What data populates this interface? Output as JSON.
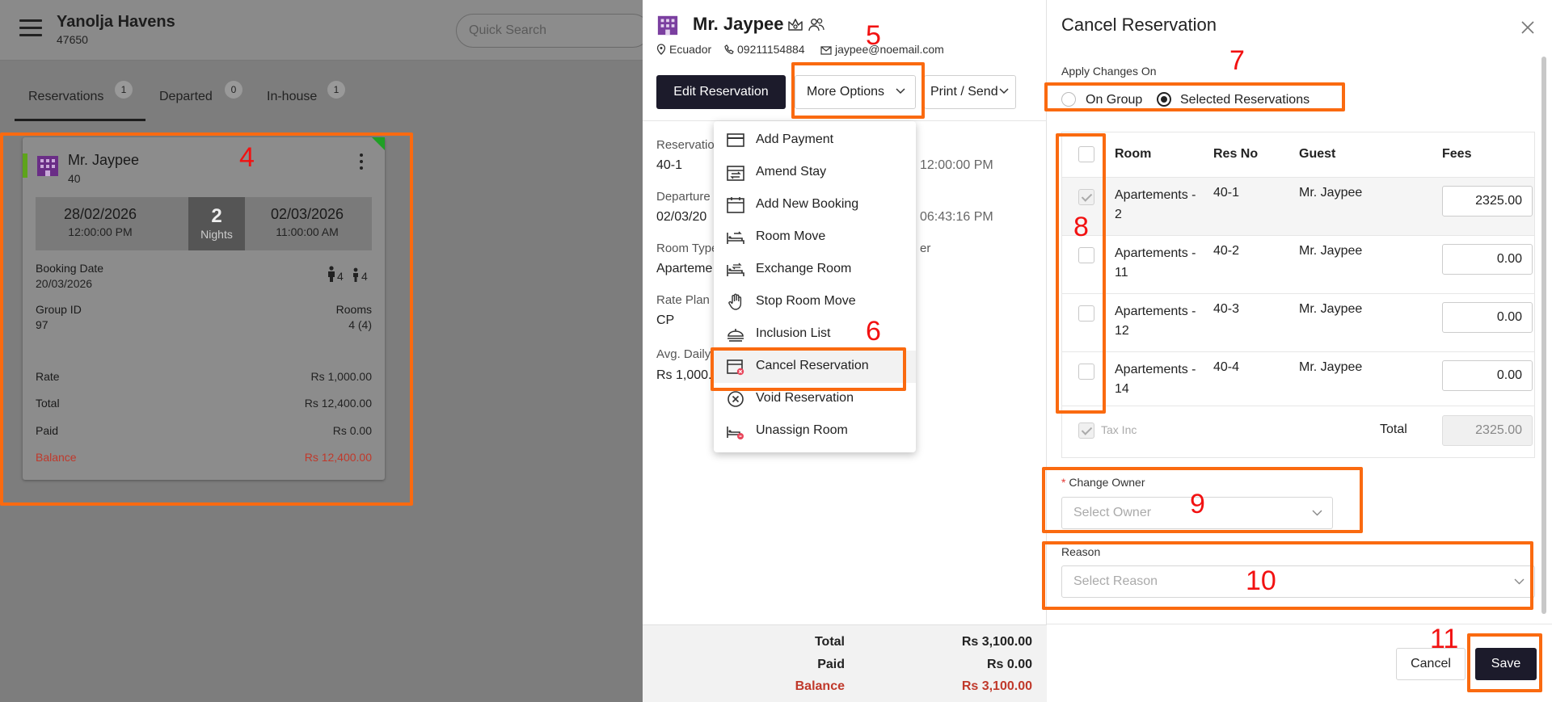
{
  "app": {
    "hotel_name": "Yanolja Havens",
    "hotel_code": "47650",
    "search_placeholder": "Quick Search",
    "tabs": [
      {
        "label": "Reservations",
        "count": "1"
      },
      {
        "label": "Departed",
        "count": "0"
      },
      {
        "label": "In-house",
        "count": "1"
      }
    ]
  },
  "card": {
    "name": "Mr. Jaypee",
    "id": "40",
    "arrival_date": "28/02/2026",
    "arrival_time": "12:00:00 PM",
    "nights": "2",
    "nights_label": "Nights",
    "departure_date": "02/03/2026",
    "departure_time": "11:00:00 AM",
    "booking_date_label": "Booking Date",
    "booking_date": "20/03/2026",
    "adults": "4",
    "children": "4",
    "group_id_label": "Group ID",
    "group_id": "97",
    "rooms_label": "Rooms",
    "rooms": "4 (4)",
    "rate_label": "Rate",
    "rate": "Rs 1,000.00",
    "total_label": "Total",
    "total": "Rs 12,400.00",
    "paid_label": "Paid",
    "paid": "Rs 0.00",
    "balance_label": "Balance",
    "balance": "Rs 12,400.00"
  },
  "detail": {
    "guest_name": "Mr. Jaypee",
    "country": "Ecuador",
    "phone": "09211154884",
    "email": "jaypee@noemail.com",
    "edit_button": "Edit Reservation",
    "more_button": "More Options",
    "print_button": "Print / Send",
    "fields": {
      "reservation_label": "Reservatio",
      "reservation_value": "40-1",
      "arrival_time_tail": "12:00:00 PM",
      "departure_label": "Departure",
      "departure_value": "02/03/20",
      "departure_time_tail": "06:43:16 PM",
      "room_type_label": "Room Type",
      "room_type_value": "Aparteme",
      "owner_tail": "er",
      "rate_plan_label": "Rate Plan",
      "rate_plan_value": "CP",
      "avg_label": "Avg. Daily",
      "avg_value": "Rs 1,000."
    },
    "footer": {
      "total_label": "Total",
      "total": "Rs 3,100.00",
      "paid_label": "Paid",
      "paid": "Rs 0.00",
      "balance_label": "Balance",
      "balance": "Rs 3,100.00"
    }
  },
  "more_options_menu": [
    {
      "label": "Add Payment",
      "icon": "card-icon"
    },
    {
      "label": "Amend Stay",
      "icon": "calendar-swap-icon"
    },
    {
      "label": "Add New Booking",
      "icon": "calendar-icon"
    },
    {
      "label": "Room Move",
      "icon": "bed-move-icon"
    },
    {
      "label": "Exchange Room",
      "icon": "bed-exchange-icon"
    },
    {
      "label": "Stop Room Move",
      "icon": "hand-stop-icon"
    },
    {
      "label": "Inclusion List",
      "icon": "cutlery-icon"
    },
    {
      "label": "Cancel Reservation",
      "icon": "calendar-cancel-icon"
    },
    {
      "label": "Void Reservation",
      "icon": "circle-x-icon"
    },
    {
      "label": "Unassign Room",
      "icon": "bed-unassign-icon"
    }
  ],
  "cancel_panel": {
    "title": "Cancel Reservation",
    "apply_label": "Apply Changes On",
    "option_group": "On Group",
    "option_selected": "Selected Reservations",
    "selected_option": "Selected Reservations",
    "columns": [
      "Room",
      "Res No",
      "Guest",
      "Fees"
    ],
    "rows": [
      {
        "room": "Apartements - 2",
        "res_no": "40-1",
        "guest": "Mr. Jaypee",
        "fee": "2325.00",
        "checked": true
      },
      {
        "room": "Apartements - 11",
        "res_no": "40-2",
        "guest": "Mr. Jaypee",
        "fee": "0.00",
        "checked": false
      },
      {
        "room": "Apartements - 12",
        "res_no": "40-3",
        "guest": "Mr. Jaypee",
        "fee": "0.00",
        "checked": false
      },
      {
        "room": "Apartements - 14",
        "res_no": "40-4",
        "guest": "Mr. Jaypee",
        "fee": "0.00",
        "checked": false
      }
    ],
    "tax_inc_label": "Tax Inc",
    "total_label": "Total",
    "total": "2325.00",
    "change_owner_label": "Change Owner",
    "owner_placeholder": "Select Owner",
    "reason_label": "Reason",
    "reason_placeholder": "Select Reason",
    "cancel_button": "Cancel",
    "save_button": "Save"
  },
  "annotations": [
    "4",
    "5",
    "6",
    "7",
    "8",
    "9",
    "10",
    "11"
  ],
  "colors": {
    "annotation_box": "#fa6a10",
    "annotation_number": "#f21111",
    "primary_button": "#1c1b2b",
    "balance_red": "#c0392b"
  }
}
